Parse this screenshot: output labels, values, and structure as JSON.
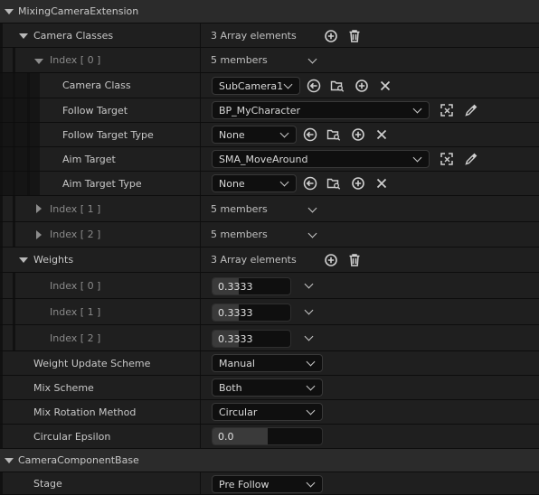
{
  "sections": {
    "mixing": "MixingCameraExtension",
    "base": "CameraComponentBase"
  },
  "camera_classes": {
    "label": "Camera Classes",
    "value": "3 Array elements",
    "index0": {
      "label": "Index [ 0 ]",
      "value": "5 members",
      "camera_class": {
        "label": "Camera Class",
        "value": "SubCamera1"
      },
      "follow_target": {
        "label": "Follow Target",
        "value": "BP_MyCharacter"
      },
      "follow_target_type": {
        "label": "Follow Target Type",
        "value": "None"
      },
      "aim_target": {
        "label": "Aim Target",
        "value": "SMA_MoveAround"
      },
      "aim_target_type": {
        "label": "Aim Target Type",
        "value": "None"
      }
    },
    "index1": {
      "label": "Index [ 1 ]",
      "value": "5 members"
    },
    "index2": {
      "label": "Index [ 2 ]",
      "value": "5 members"
    }
  },
  "weights": {
    "label": "Weights",
    "value": "3 Array elements",
    "items": [
      {
        "label": "Index [ 0 ]",
        "value": "0.3333",
        "fraction": 0.3333
      },
      {
        "label": "Index [ 1 ]",
        "value": "0.3333",
        "fraction": 0.3333
      },
      {
        "label": "Index [ 2 ]",
        "value": "0.3333",
        "fraction": 0.3333
      }
    ]
  },
  "weight_update_scheme": {
    "label": "Weight Update Scheme",
    "value": "Manual"
  },
  "mix_scheme": {
    "label": "Mix Scheme",
    "value": "Both"
  },
  "mix_rotation_method": {
    "label": "Mix Rotation Method",
    "value": "Circular"
  },
  "circular_epsilon": {
    "label": "Circular Epsilon",
    "value": "0.0",
    "fraction": 0.5
  },
  "stage": {
    "label": "Stage",
    "value": "Pre Follow"
  },
  "icons": [
    "plus-circle-icon",
    "trash-icon",
    "arrow-left-circle-icon",
    "browse-folder-icon",
    "close-icon",
    "pick-actor-icon",
    "eyedropper-icon",
    "chevron-down-icon",
    "expand-arrow-icon",
    "collapse-arrow-icon"
  ],
  "colors": {
    "background": "#151515",
    "row": "#1f1f1f",
    "category": "#2b2b2b",
    "field": "#0f0f0f",
    "text": "#c0c0c0"
  }
}
